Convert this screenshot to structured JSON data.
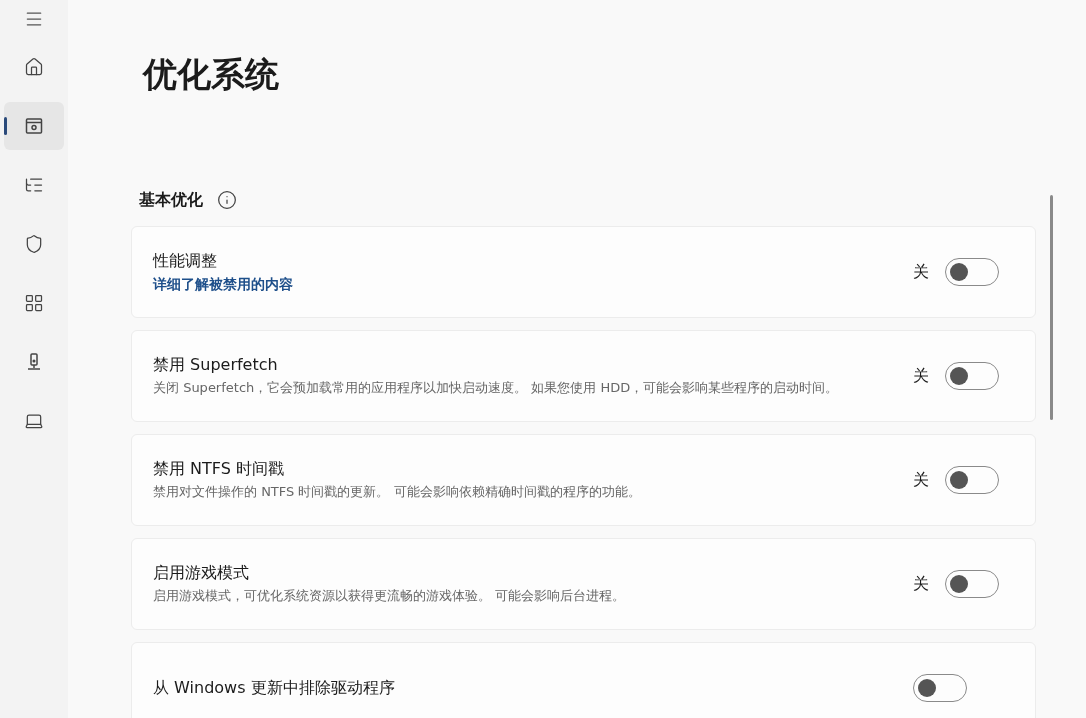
{
  "sidebar": {
    "items": [
      {
        "selected": false
      },
      {
        "selected": true
      },
      {
        "selected": false
      },
      {
        "selected": false
      },
      {
        "selected": false
      },
      {
        "selected": false
      },
      {
        "selected": false
      }
    ]
  },
  "page_title": "优化系统",
  "section": {
    "title": "基本优化"
  },
  "settings": [
    {
      "title": "性能调整",
      "link": "详细了解被禁用的内容",
      "state_label": "关",
      "on": false
    },
    {
      "title": "禁用 Superfetch",
      "description": "关闭 Superfetch，它会预加载常用的应用程序以加快启动速度。 如果您使用 HDD，可能会影响某些程序的启动时间。",
      "state_label": "关",
      "on": false
    },
    {
      "title": "禁用 NTFS 时间戳",
      "description": "禁用对文件操作的 NTFS 时间戳的更新。 可能会影响依赖精确时间戳的程序的功能。",
      "state_label": "关",
      "on": false
    },
    {
      "title": "启用游戏模式",
      "description": "启用游戏模式，可优化系统资源以获得更流畅的游戏体验。 可能会影响后台进程。",
      "state_label": "关",
      "on": false
    },
    {
      "title": "从 Windows 更新中排除驱动程序",
      "on": false
    }
  ]
}
